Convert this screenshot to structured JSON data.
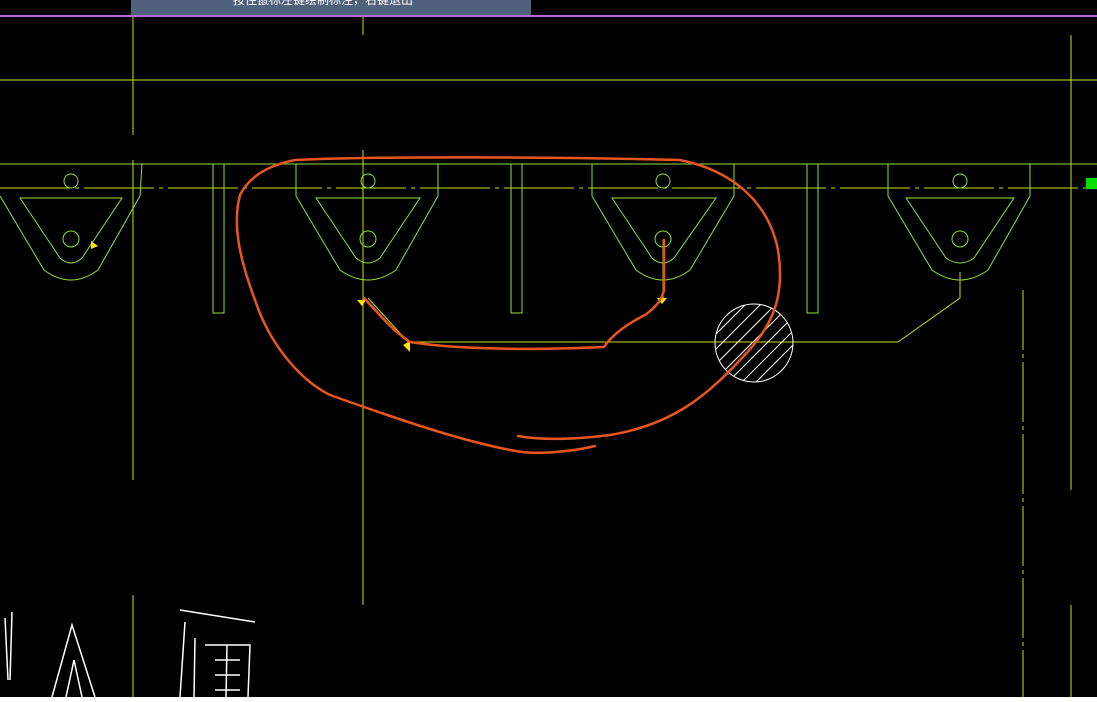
{
  "viewport": {
    "background": "#000000"
  },
  "tooltip": {
    "text": "按住鼠标左键绘制标注，右键退出",
    "background": "#50617d",
    "text_color": "#ffffff"
  },
  "colors": {
    "drawing_lines": "#c8e000",
    "brackets": "#8fe03a",
    "markup": "#e8561e",
    "grip_markers": "#ffe600",
    "hatch": "#ffffff",
    "grip_square": "#00e000",
    "window_border": "#b06ad8"
  },
  "icons": {
    "grip_square": "green-grip-square-icon",
    "snap_markers": "yellow-snap-marker-icon"
  }
}
